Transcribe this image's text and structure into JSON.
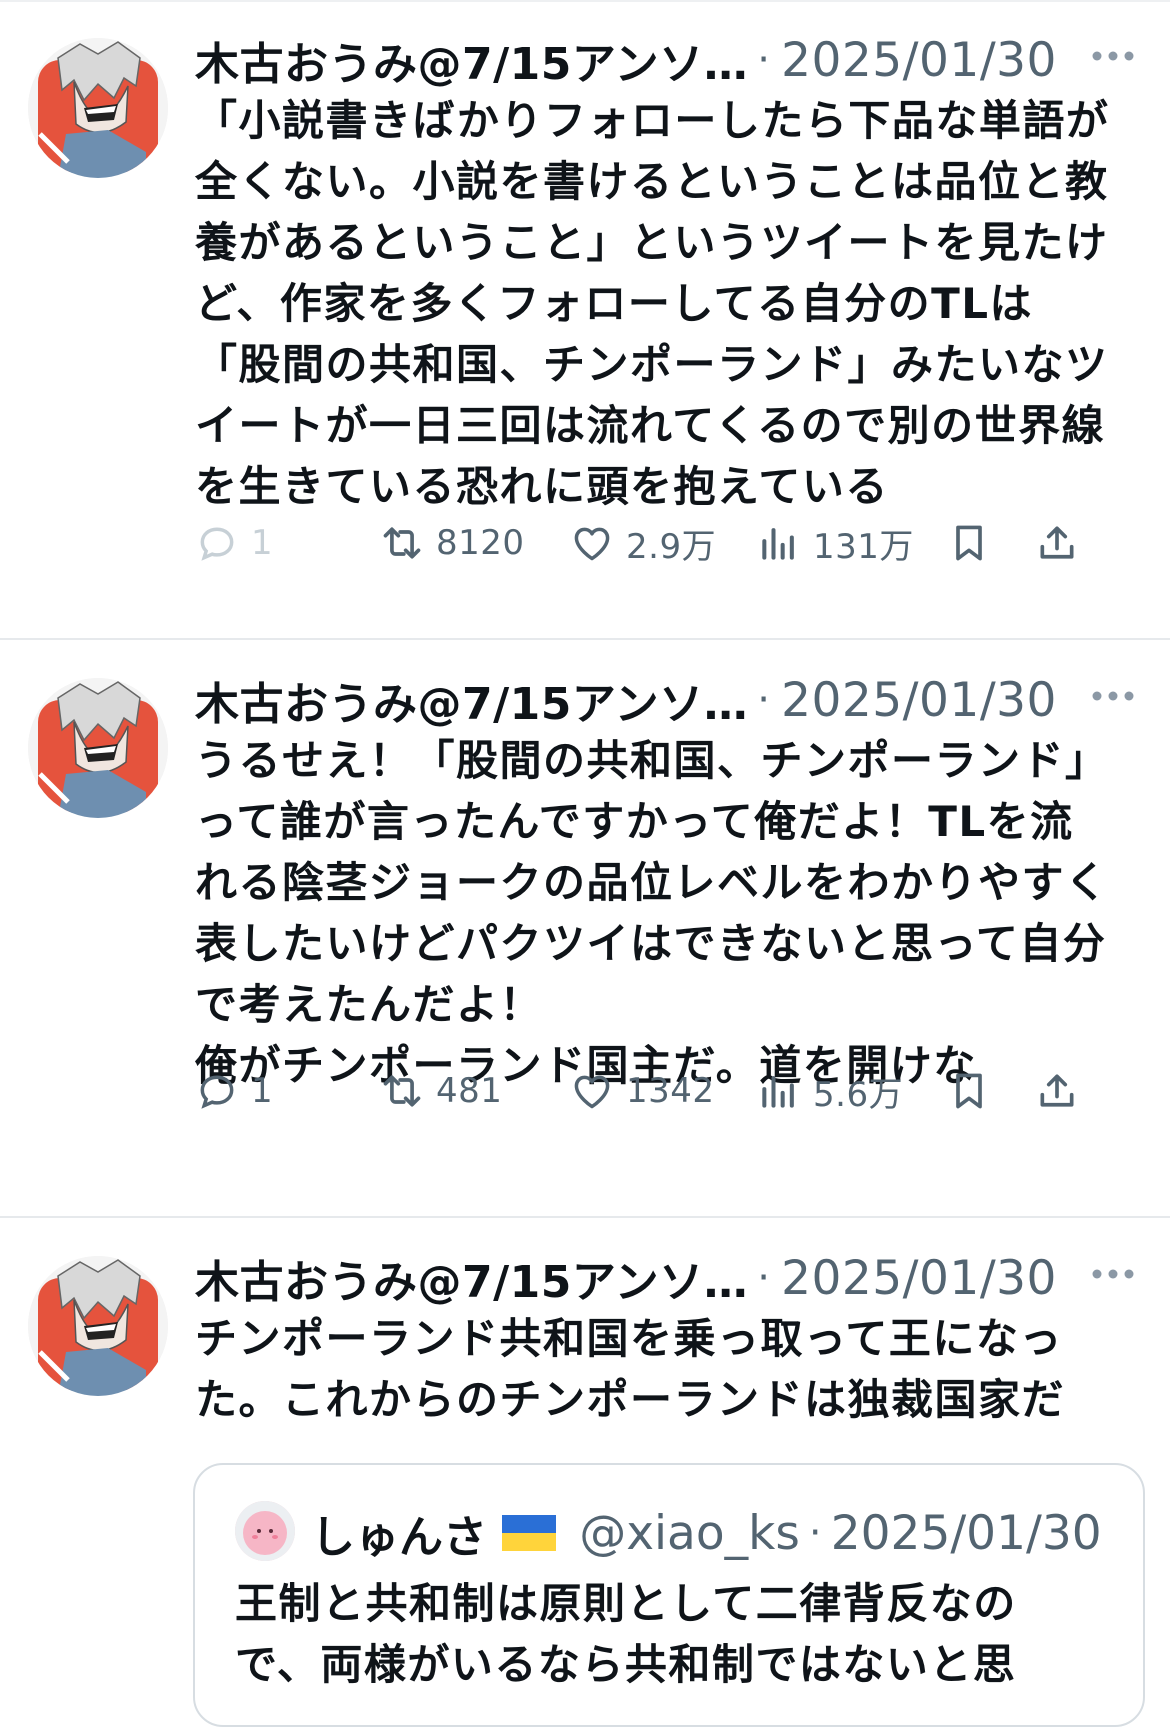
{
  "tweets": [
    {
      "author": "木古おうみ@7/15アンソ…",
      "separator": "·",
      "date": "2025/01/30",
      "text": "「小説書きばかりフォローしたら下品な単語が\n全くない。小説を書けるということは品位と教\n養があるということ」というツイートを見たけ\nど、作家を多くフォローしてる自分のTLは\n「股間の共和国、チンポーランド」みたいなツ\nイートが一日三回は流れてくるので別の世界線\nを生きている恐れに頭を抱えている",
      "replies": "1",
      "reposts": "8120",
      "likes": "2.9万",
      "views": "131万"
    },
    {
      "author": "木古おうみ@7/15アンソ…",
      "separator": "·",
      "date": "2025/01/30",
      "text": "うるせえ！「股間の共和国、チンポーランド」\nって誰が言ったんですかって俺だよ！TLを流\nれる陰茎ジョークの品位レベルをわかりやすく\n表したいけどパクツイはできないと思って自分\nで考えたんだよ！\n俺がチンポーランド国主だ。道を開けな",
      "replies": "1",
      "reposts": "481",
      "likes": "1342",
      "views": "5.6万"
    },
    {
      "author": "木古おうみ@7/15アンソ…",
      "separator": "·",
      "date": "2025/01/30",
      "text": "チンポーランド共和国を乗っ取って王になっ\nた。これからのチンポーランドは独裁国家だ",
      "quote": {
        "name": "しゅんさ",
        "flag": "ukraine-flag",
        "handle": "@xiao_ks",
        "separator": "·",
        "date": "2025/01/30",
        "text_line1": "王制と共和制は原則として二律背反なの",
        "text_line2": "で、両様がいるなら共和制ではないと思"
      }
    }
  ],
  "colors": {
    "text": "#0f1419",
    "secondary": "#536471",
    "divider": "#e6e9ec",
    "avatar_bg": "#e5533d"
  }
}
